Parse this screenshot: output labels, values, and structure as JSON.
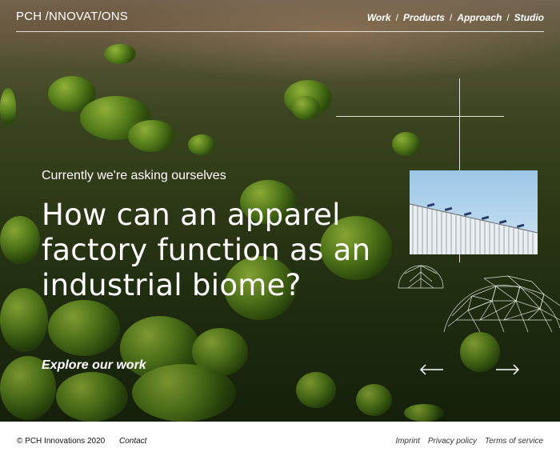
{
  "header": {
    "logo": "PCH /NNOVAT/ONS",
    "nav": [
      "Work",
      "Products",
      "Approach",
      "Studio"
    ],
    "separator": "/"
  },
  "hero": {
    "eyebrow": "Currently we're asking ourselves",
    "headline": "How can an apparel factory function as an industrial biome?",
    "cta": "Explore our work",
    "prev_arrow": "←",
    "next_arrow": "→"
  },
  "footer": {
    "copyright": "© PCH Innovations 2020",
    "contact": "Contact",
    "links": [
      "Imprint",
      "Privacy policy",
      "Terms of service"
    ]
  },
  "colors": {
    "text_on_hero": "#ffffff",
    "moss_green": "#5f8a1e",
    "footer_bg": "#ffffff"
  },
  "icons": [
    "arrow-left-icon",
    "arrow-right-icon"
  ]
}
